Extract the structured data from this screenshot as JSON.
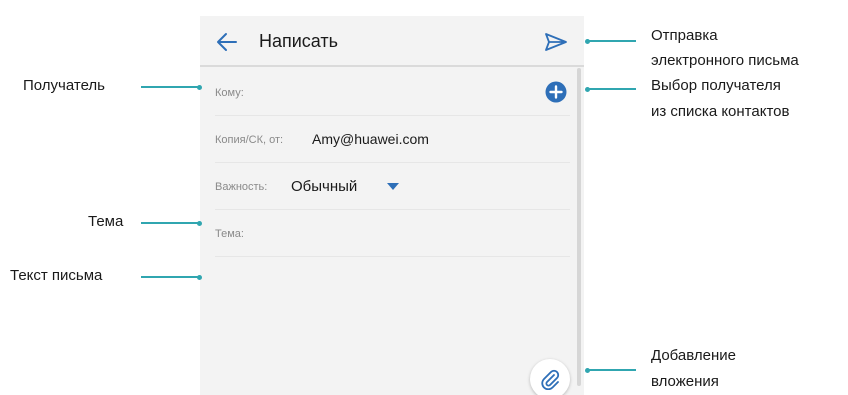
{
  "app": {
    "title": "Написать"
  },
  "colors": {
    "accent": "#2e6fb8",
    "callout_line": "#30a6b0",
    "background": "#f3f3f3"
  },
  "icons": {
    "back": "arrow-left-icon",
    "send": "paper-plane-icon",
    "add_recipient": "plus-circle-icon",
    "dropdown": "triangle-down-icon",
    "attach": "paperclip-icon"
  },
  "form": {
    "to_label": "Кому:",
    "cc_label": "Копия/СК, от:",
    "cc_value": "Amy@huawei.com",
    "priority_label": "Важность:",
    "priority_value": "Обычный",
    "subject_label": "Тема:"
  },
  "callouts": {
    "left": {
      "recipient": "Получатель",
      "subject": "Тема",
      "body": "Текст письма"
    },
    "right": {
      "send": [
        "Отправка",
        "электронного письма"
      ],
      "pick_contacts": [
        "Выбор получателя",
        "из списка контактов"
      ],
      "attach": [
        "Добавление",
        "вложения"
      ]
    }
  }
}
